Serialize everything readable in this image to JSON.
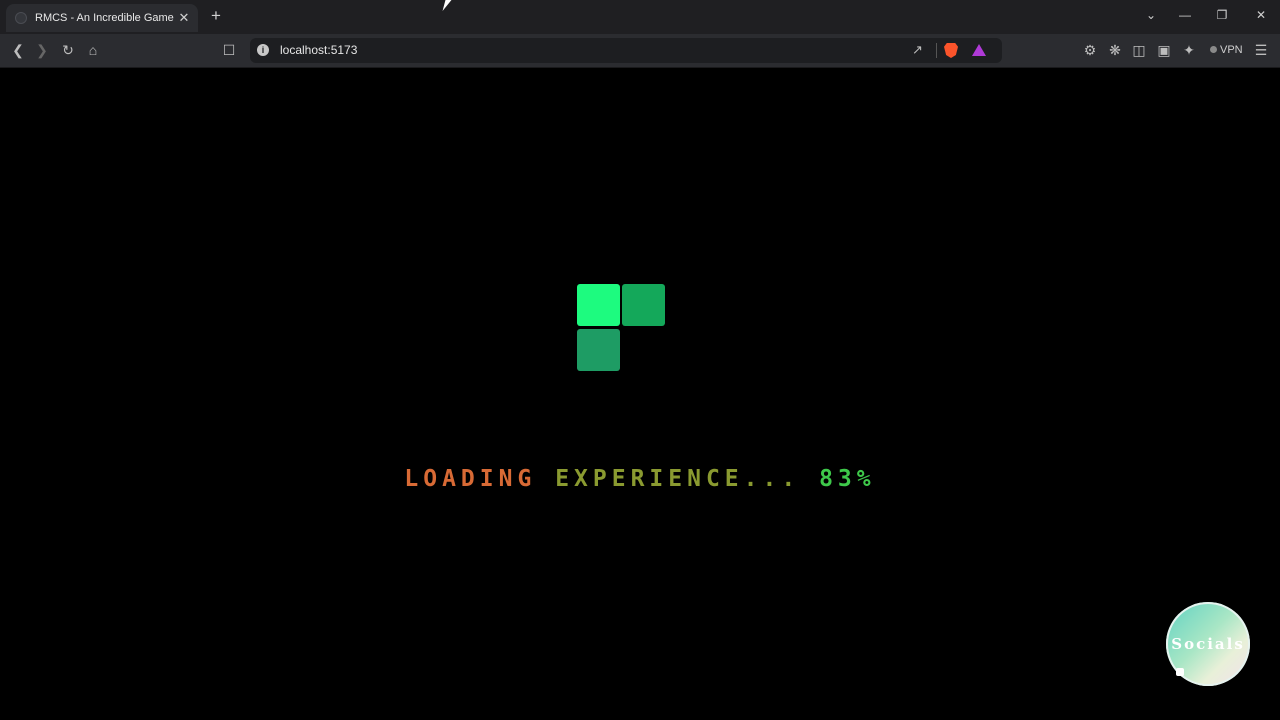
{
  "browser": {
    "tab_title": "RMCS - An Incredible Game",
    "url": "localhost:5173",
    "vpn_label": "VPN",
    "new_tab_glyph": "+",
    "close_glyph": "✕"
  },
  "loader": {
    "text_part1": "LOADING",
    "text_part2": "EXPERIENCE...",
    "percent": "83%",
    "progress": 0.83,
    "block_colors": [
      "#1dfb7f",
      "#14a85a",
      "#1e9c64"
    ]
  },
  "socials_button": {
    "label": "Socials"
  },
  "colors": {
    "background": "#000000",
    "chrome": "#2b2c30",
    "loading_start": "#d86a35",
    "loading_end": "#3ec84a"
  }
}
